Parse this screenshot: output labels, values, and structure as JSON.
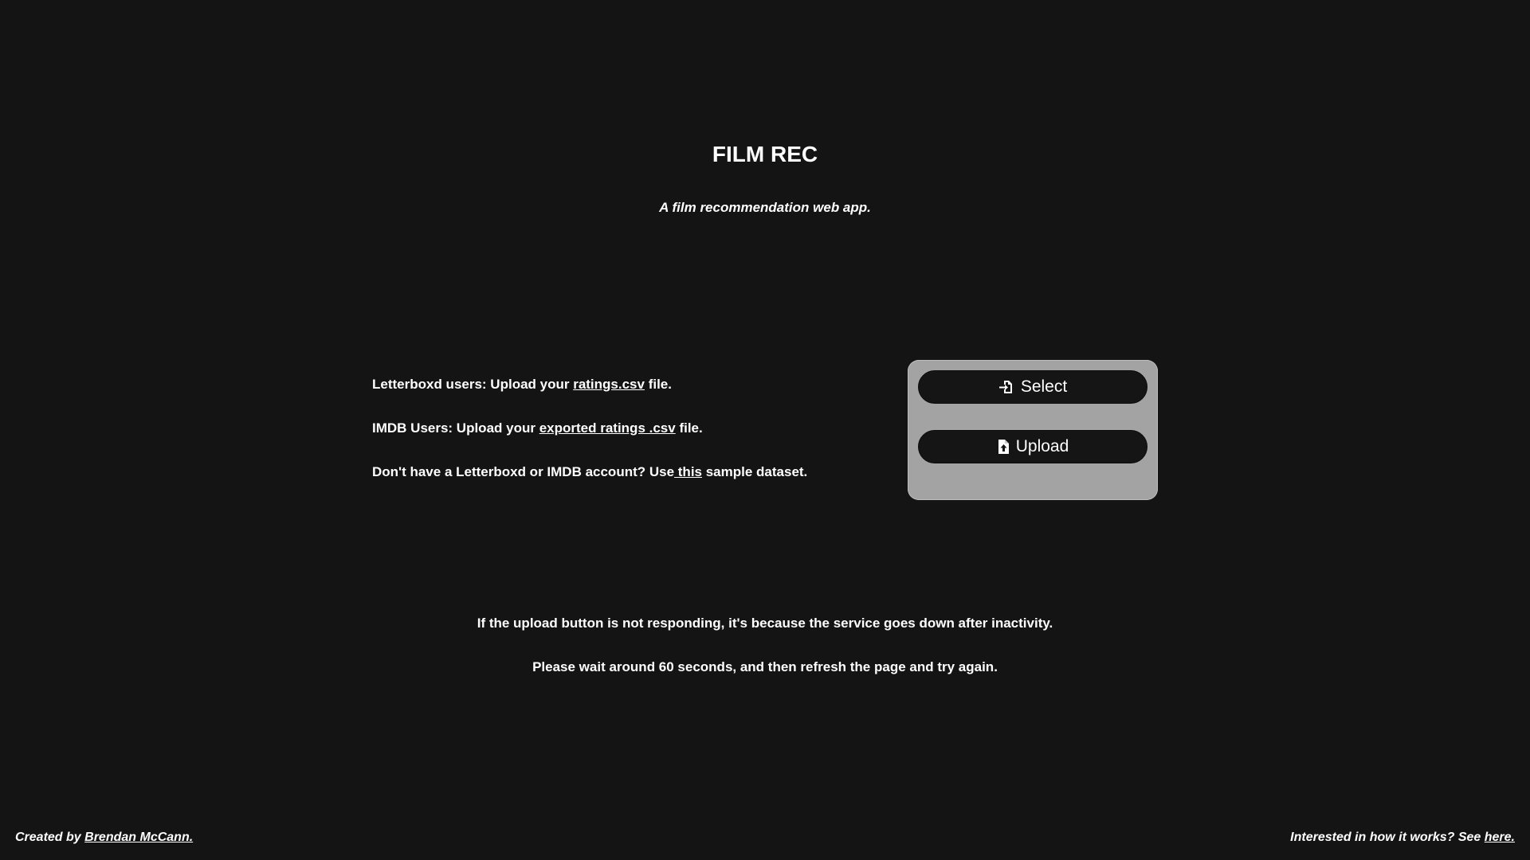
{
  "header": {
    "title": "FILM REC",
    "subtitle": "A film recommendation web app."
  },
  "instructions": {
    "letterboxd_prefix": "Letterboxd users: Upload your ",
    "letterboxd_link": "ratings.csv",
    "letterboxd_suffix": " file.",
    "imdb_prefix": "IMDB Users: Upload your ",
    "imdb_link": "exported ratings .csv",
    "imdb_suffix": " file.",
    "sample_prefix": "Don't have a Letterboxd or IMDB account? Use",
    "sample_link": " this",
    "sample_suffix": " sample dataset."
  },
  "upload_panel": {
    "select_label": "Select",
    "select_icon": "file-import-icon",
    "upload_label": "Upload",
    "upload_icon": "file-upload-icon"
  },
  "notices": {
    "line1": "If the upload button is not responding, it's because the service goes down after inactivity.",
    "line2": "Please wait around 60 seconds, and then refresh the page and try again."
  },
  "footer": {
    "created_prefix": "Created by ",
    "author_link": "Brendan McCann.",
    "how_prefix": "Interested in how it works? See ",
    "how_link": "here."
  },
  "colors": {
    "background": "#141414",
    "text": "#ffffff",
    "panel": "#a3a3a3",
    "button": "#151515"
  }
}
